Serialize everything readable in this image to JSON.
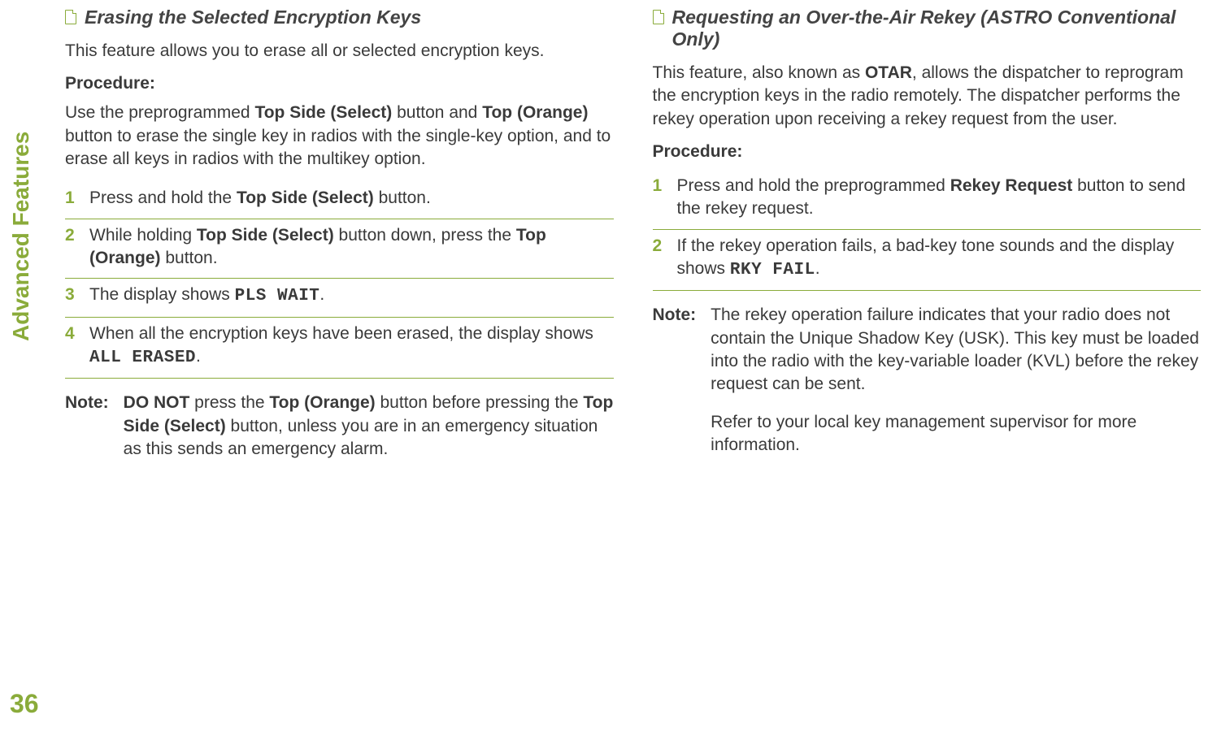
{
  "sideTab": "Advanced Features",
  "pageNumber": "36",
  "left": {
    "title": "Erasing the Selected Encryption Keys",
    "intro": "This feature allows you to erase all or selected encryption keys.",
    "procLabel": "Procedure:",
    "procText_pre": "Use the preprogrammed ",
    "procText_b1": "Top Side (Select)",
    "procText_mid1": " button and ",
    "procText_b2": "Top (Orange)",
    "procText_post": " button to erase the single key in radios with the single-key option, and to erase all keys in radios with the multikey option.",
    "steps": [
      {
        "n": "1",
        "pre": "Press and hold the ",
        "b": "Top Side (Select)",
        "post": " button."
      },
      {
        "n": "2",
        "pre": "While holding ",
        "b": "Top Side (Select)",
        "mid": " button down, press the ",
        "b2": "Top (Orange)",
        "post": " button."
      },
      {
        "n": "3",
        "pre": "The display shows ",
        "code": "PLS WAIT",
        "post": "."
      },
      {
        "n": "4",
        "pre": "When all the encryption keys have been erased, the display shows ",
        "code": "ALL ERASED",
        "post": "."
      }
    ],
    "noteLabel": "Note:",
    "note_b1": "DO NOT",
    "note_t1": " press the ",
    "note_b2": "Top (Orange)",
    "note_t2": " button before pressing the ",
    "note_b3": "Top Side (Select)",
    "note_t3": " button, unless you are in an emergency situation as this sends an emergency alarm."
  },
  "right": {
    "title": "Requesting an Over-the-Air Rekey (ASTRO Conventional Only)",
    "intro_pre": "This feature, also known as ",
    "intro_b": "OTAR",
    "intro_post": ", allows the dispatcher to reprogram the encryption keys in the radio remotely. The dispatcher performs the rekey operation upon receiving a rekey request from the user.",
    "procLabel": "Procedure:",
    "steps": [
      {
        "n": "1",
        "pre": "Press and hold the preprogrammed ",
        "b": "Rekey Request",
        "post": " button to send the rekey request."
      },
      {
        "n": "2",
        "pre": "If the rekey operation fails, a bad-key tone sounds and the display shows ",
        "code": "RKY FAIL",
        "post": "."
      }
    ],
    "noteLabel": "Note:",
    "note_p1": "The rekey operation failure indicates that your radio does not contain the Unique Shadow Key (USK). This key must be loaded into the radio with the key-variable loader (KVL) before the rekey request can be sent.",
    "note_p2": "Refer to your local key management supervisor for more information."
  }
}
